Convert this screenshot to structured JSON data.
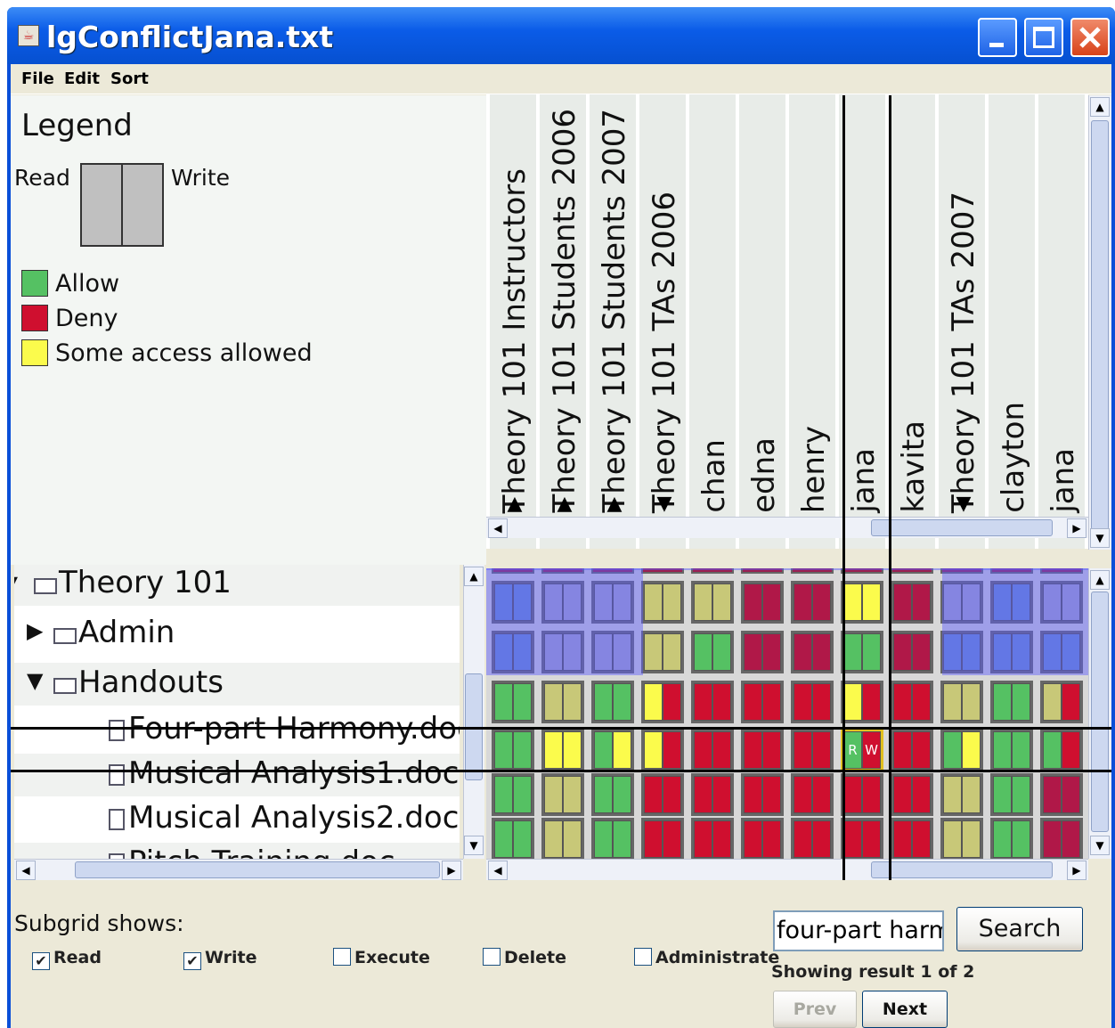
{
  "window": {
    "title": "lgConflictJana.txt"
  },
  "menu": [
    "File",
    "Edit",
    "Sort"
  ],
  "legend": {
    "title": "Legend",
    "read_label": "Read",
    "write_label": "Write",
    "items": [
      {
        "label": "Allow",
        "color": "#55c163"
      },
      {
        "label": "Deny",
        "color": "#cf0f2f"
      },
      {
        "label": "Some access allowed",
        "color": "#fbfb4c"
      }
    ]
  },
  "columns": [
    {
      "label": "Theory 101 Instructors",
      "arrow": "▲"
    },
    {
      "label": "Theory 101 Students 2006",
      "arrow": "▲"
    },
    {
      "label": "Theory 101 Students 2007",
      "arrow": "▲"
    },
    {
      "label": "Theory 101 TAs 2006",
      "arrow": "▼"
    },
    {
      "label": "chan",
      "arrow": ""
    },
    {
      "label": "edna",
      "arrow": ""
    },
    {
      "label": "henry",
      "arrow": ""
    },
    {
      "label": "jana",
      "arrow": ""
    },
    {
      "label": "kavita",
      "arrow": ""
    },
    {
      "label": "Theory 101 TAs 2007",
      "arrow": "▼"
    },
    {
      "label": "clayton",
      "arrow": ""
    },
    {
      "label": "jana",
      "arrow": ""
    }
  ],
  "tree": [
    {
      "label": "Theory 101",
      "toggle": "▾",
      "kind": "folder"
    },
    {
      "label": "Admin",
      "toggle": "▶",
      "kind": "folder"
    },
    {
      "label": "Handouts",
      "toggle": "▼",
      "kind": "folder"
    },
    {
      "label": "Four-part Harmony.doc",
      "toggle": "",
      "kind": "file"
    },
    {
      "label": "Musical Analysis1.doc",
      "toggle": "",
      "kind": "file"
    },
    {
      "label": "Musical Analysis2.doc",
      "toggle": "",
      "kind": "file"
    },
    {
      "label": "Pitch Training.doc",
      "toggle": "",
      "kind": "file"
    }
  ],
  "grid": {
    "palette": {
      "G": "#55c163",
      "R": "#cf0f2f",
      "Y": "#fbfb4c",
      "B": "#6a8fd0",
      "P": "#a8a8c8",
      "O": "#c8c878",
      "M": "#b01848"
    },
    "rows": [
      [
        "BB",
        "PP",
        "PP",
        "OO",
        "OO",
        "MM",
        "MM",
        "YY",
        "MM",
        "PP",
        "BB",
        "PP"
      ],
      [
        "BB",
        "PP",
        "PP",
        "OO",
        "GG",
        "MM",
        "MM",
        "GG",
        "MM",
        "BB",
        "BB",
        "BB"
      ],
      [
        "GG",
        "OO",
        "GG",
        "YR",
        "RR",
        "RR",
        "RR",
        "YR",
        "RR",
        "OO",
        "GG",
        "OR"
      ],
      [
        "GG",
        "YY",
        "GY",
        "YR",
        "RR",
        "RR",
        "RR",
        "RW",
        "RR",
        "GY",
        "GG",
        "GR"
      ],
      [
        "GG",
        "OO",
        "GG",
        "RR",
        "RR",
        "RR",
        "RR",
        "RR",
        "RR",
        "OO",
        "GG",
        "MM"
      ],
      [
        "GG",
        "OO",
        "GG",
        "RR",
        "RR",
        "RR",
        "RR",
        "RR",
        "RR",
        "OO",
        "GG",
        "MM"
      ]
    ],
    "selected_cell_text": {
      "read": "R",
      "write": "W"
    }
  },
  "subgrid": {
    "label": "Subgrid shows:",
    "options": [
      {
        "label": "Read",
        "checked": "✔"
      },
      {
        "label": "Write",
        "checked": "✔"
      },
      {
        "label": "Execute",
        "checked": ""
      },
      {
        "label": "Delete",
        "checked": ""
      },
      {
        "label": "Administrate",
        "checked": ""
      }
    ]
  },
  "search": {
    "value": "four-part harmo",
    "button": "Search",
    "status": "Showing result 1 of 2",
    "prev": "Prev",
    "next": "Next"
  },
  "scroll_icons": {
    "up": "▲",
    "down": "▼",
    "left": "◀",
    "right": "▶",
    "grip": "|||"
  }
}
